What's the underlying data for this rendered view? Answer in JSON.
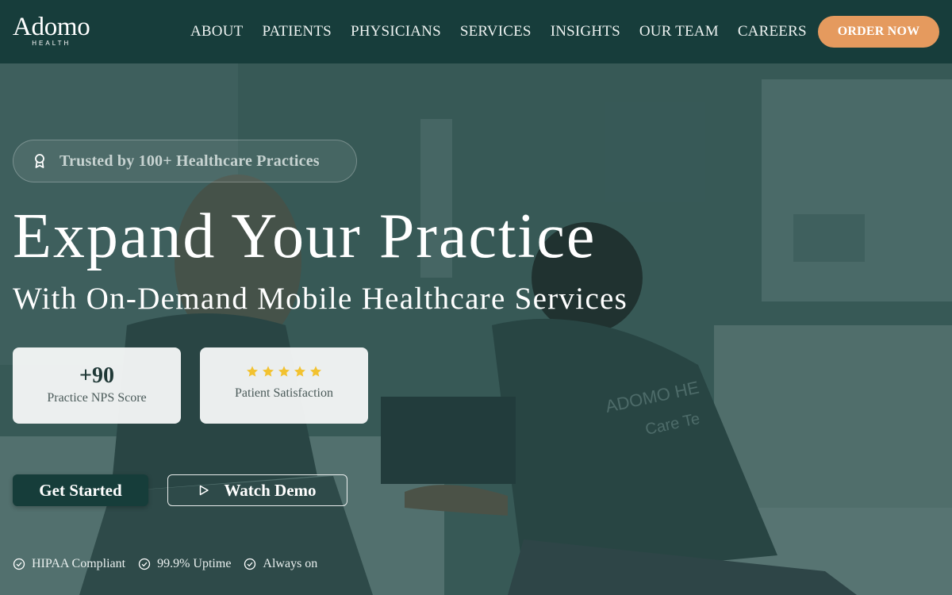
{
  "brand": {
    "name": "Adomo",
    "tagline": "HEALTH"
  },
  "nav": {
    "items": [
      {
        "label": "ABOUT"
      },
      {
        "label": "PATIENTS"
      },
      {
        "label": "PHYSICIANS"
      },
      {
        "label": "SERVICES"
      },
      {
        "label": "INSIGHTS"
      },
      {
        "label": "OUR TEAM"
      },
      {
        "label": "CAREERS"
      }
    ],
    "cta": "ORDER NOW"
  },
  "hero": {
    "badge": "Trusted by 100+ Healthcare Practices",
    "badge_icon": "award-icon",
    "title": "Expand Your Practice",
    "subtitle": "With On-Demand Mobile Healthcare Services",
    "stats": [
      {
        "value": "+90",
        "label": "Practice NPS Score"
      },
      {
        "rating": 5,
        "rating_max": 5,
        "label": "Patient Satisfaction"
      }
    ],
    "primary_button": "Get Started",
    "secondary_button": "Watch Demo",
    "features": [
      {
        "label": "HIPAA Compliant"
      },
      {
        "label": "99.9% Uptime"
      },
      {
        "label": "Always on"
      }
    ],
    "photo_shirt_text": "ADOMO HE... Care Te..."
  },
  "colors": {
    "header_bg": "#173d3b",
    "accent": "#e59a5e",
    "primary_button": "#163d3a",
    "star": "#f2c230"
  }
}
